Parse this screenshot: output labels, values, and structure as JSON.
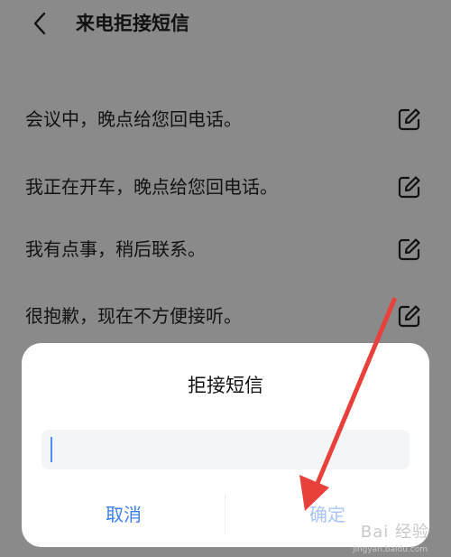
{
  "header": {
    "title": "来电拒接短信",
    "back_icon": "chevron-left-icon"
  },
  "messages": [
    {
      "text": "会议中，晚点给您回电话。",
      "icon": "edit-icon"
    },
    {
      "text": "我正在开车，晚点给您回电话。",
      "icon": "edit-icon"
    },
    {
      "text": "我有点事，稍后联系。",
      "icon": "edit-icon"
    },
    {
      "text": "很抱歉，现在不方便接听。",
      "icon": "edit-icon"
    }
  ],
  "dialog": {
    "title": "拒接短信",
    "input_value": "",
    "cancel_label": "取消",
    "confirm_label": "确定"
  },
  "watermark": {
    "main": "Bai 经验",
    "sub": "jingyan.baidu.com"
  },
  "colors": {
    "overlay": "#8a8a8a",
    "accent": "#3b7ff5",
    "accent_disabled": "#a9c6f7",
    "arrow": "#e8403a"
  }
}
